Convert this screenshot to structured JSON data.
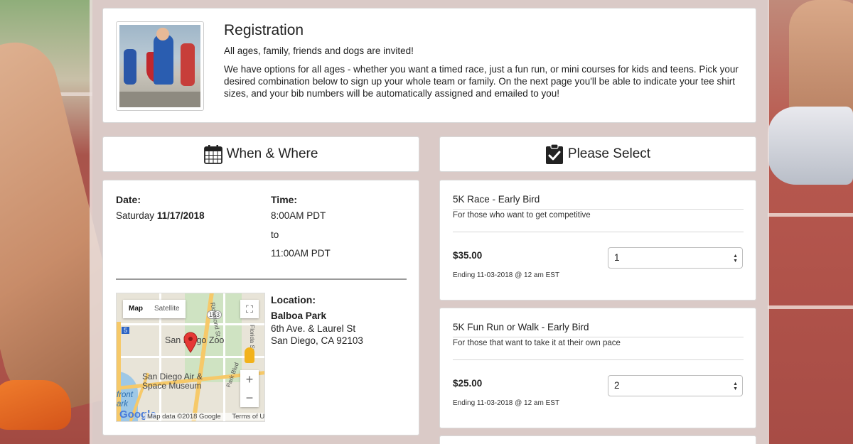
{
  "registration": {
    "title": "Registration",
    "intro": "All ages, family, friends and dogs are invited!",
    "body": "We have options for all ages - whether you want a timed race, just a fun run, or mini courses for kids and teens. Pick your desired combination below to sign up your whole team or family. On the next page you'll be able to indicate your tee shirt sizes, and your bib numbers will be automatically assigned and emailed to you!"
  },
  "when_where": {
    "header": "When & Where",
    "date_label": "Date:",
    "date_day": "Saturday",
    "date_value": "11/17/2018",
    "time_label": "Time:",
    "time_start": "8:00AM PDT",
    "time_to": "to",
    "time_end": "11:00AM PDT",
    "location_label": "Location:",
    "location_name": "Balboa Park",
    "location_street": "6th Ave. & Laurel St",
    "location_city": "San Diego, CA 92103",
    "map": {
      "type_map": "Map",
      "type_satellite": "Satellite",
      "label_zoo": "San Diego Zoo",
      "label_museum_1": "San Diego Air &",
      "label_museum_2": "Space Museum",
      "label_waterfront": "front",
      "label_park": "ark",
      "label_richmond": "Richmond St",
      "label_florida": "Florida St",
      "label_parkblvd": "Park Blvd",
      "route_163": "163",
      "route_5": "5",
      "zoom_in": "+",
      "zoom_out": "−",
      "google": "Google",
      "map_data": "Map data ©2018 Google",
      "terms": "Terms of Use"
    }
  },
  "please_select": {
    "header": "Please Select",
    "options": [
      {
        "name": "5K Race - Early Bird",
        "description": "For those who want to get competitive",
        "price": "$35.00",
        "ending": "Ending 11-03-2018 @ 12 am EST",
        "quantity": "1"
      },
      {
        "name": "5K Fun Run or Walk - Early Bird",
        "description": "For those that want to take it at their own pace",
        "price": "$25.00",
        "ending": "Ending 11-03-2018 @ 12 am EST",
        "quantity": "2"
      }
    ]
  },
  "icons": {
    "calendar": "calendar-icon",
    "clipboard": "clipboard-check-icon",
    "select_arrows": "select-arrows-icon",
    "map_pin": "map-pin-icon",
    "pegman": "pegman-icon",
    "fullscreen": "fullscreen-icon"
  },
  "colors": {
    "pin": "#e53935",
    "pegman": "#f2b21b",
    "major_road": "#f6c969",
    "park": "#cfe3c2",
    "water": "#9ec8e6"
  }
}
